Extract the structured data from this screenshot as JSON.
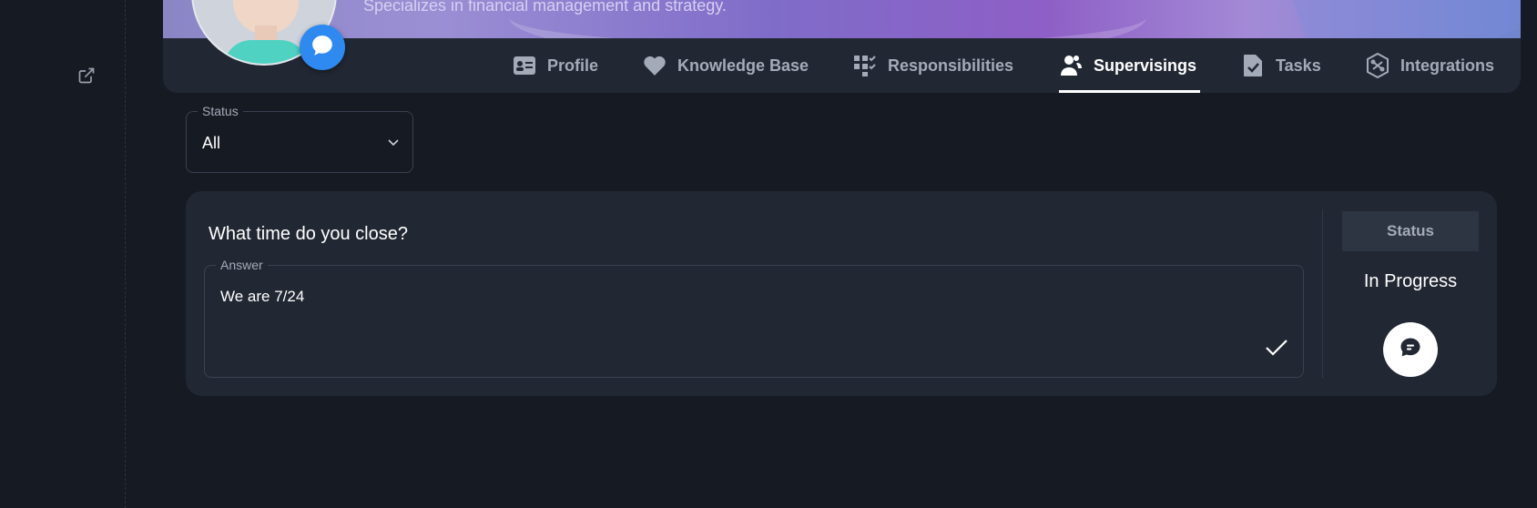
{
  "header": {
    "subtitle": "Specializes in financial management and strategy."
  },
  "tabs": [
    {
      "label": "Profile",
      "icon": "id-card-icon"
    },
    {
      "label": "Knowledge Base",
      "icon": "heart-icon"
    },
    {
      "label": "Responsibilities",
      "icon": "checklist-icon"
    },
    {
      "label": "Supervisings",
      "icon": "users-icon",
      "active": true
    },
    {
      "label": "Tasks",
      "icon": "file-check-icon"
    },
    {
      "label": "Integrations",
      "icon": "hexagon-link-icon"
    }
  ],
  "filter": {
    "label": "Status",
    "value": "All"
  },
  "item": {
    "question": "What time do you close?",
    "answer_label": "Answer",
    "answer_value": "We are 7/24",
    "status_header": "Status",
    "status_value": "In Progress"
  },
  "colors": {
    "background": "#161a22",
    "card": "#222833",
    "accent_blue": "#2e8af0",
    "muted_text": "#a4abb8"
  }
}
